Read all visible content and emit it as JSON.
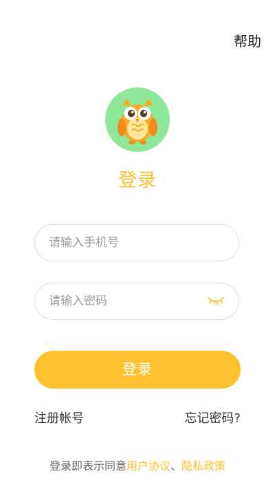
{
  "header": {
    "help_label": "帮助"
  },
  "logo": {
    "icon": "owl-logo-icon"
  },
  "title": "登录",
  "form": {
    "phone_placeholder": "请输入手机号",
    "password_placeholder": "请输入密码",
    "password_toggle_icon": "eye-closed-icon",
    "login_button_label": "登录"
  },
  "links": {
    "register_label": "注册帐号",
    "forgot_password_label": "忘记密码?"
  },
  "agreement": {
    "prefix": "登录即表示同意",
    "user_agreement_label": "用户协议",
    "separator": "、",
    "privacy_policy_label": "隐私政策"
  },
  "colors": {
    "accent": "#ffc12d",
    "logo_background": "#8fe89a"
  }
}
